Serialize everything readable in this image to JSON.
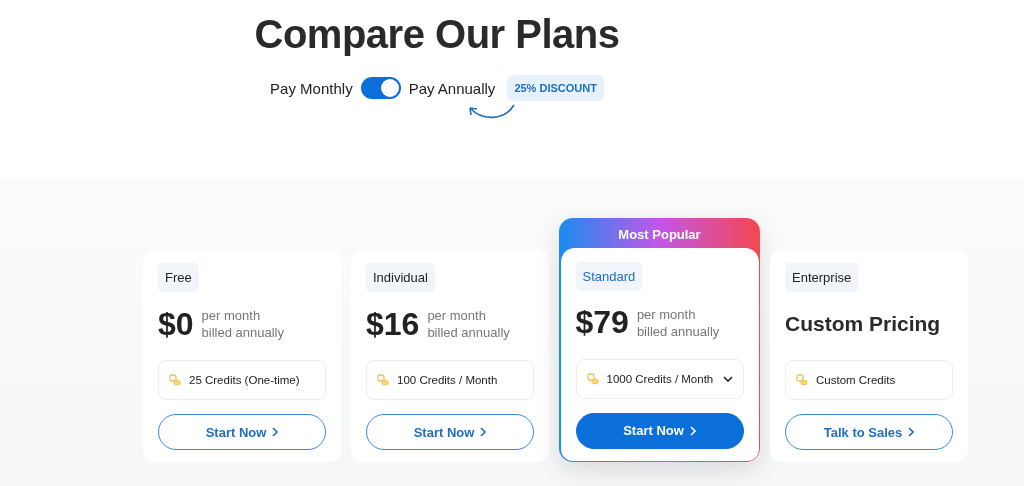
{
  "title": "Compare Our Plans",
  "billing": {
    "monthly_label": "Pay Monthly",
    "annual_label": "Pay Annually",
    "annual": true,
    "discount": "25% DISCOUNT"
  },
  "plans": [
    {
      "kind": "standard",
      "name": "Free",
      "price": "$0",
      "period": [
        "per month",
        "billed annually"
      ],
      "credits": "25 Credits (One-time)",
      "dropdown": false,
      "button": "Start Now",
      "primary": false
    },
    {
      "kind": "standard",
      "name": "Individual",
      "price": "$16",
      "period": [
        "per month",
        "billed annually"
      ],
      "credits": "100 Credits / Month",
      "dropdown": false,
      "button": "Start Now",
      "primary": false
    },
    {
      "kind": "featured",
      "badge": "Most Popular",
      "name": "Standard",
      "price": "$79",
      "period": [
        "per month",
        "billed annually"
      ],
      "credits": "1000 Credits / Month",
      "dropdown": true,
      "button": "Start Now",
      "primary": true
    },
    {
      "kind": "custom",
      "name": "Enterprise",
      "price": "Custom Pricing",
      "credits": "Custom Credits",
      "dropdown": false,
      "button": "Talk to Sales",
      "primary": false
    }
  ]
}
